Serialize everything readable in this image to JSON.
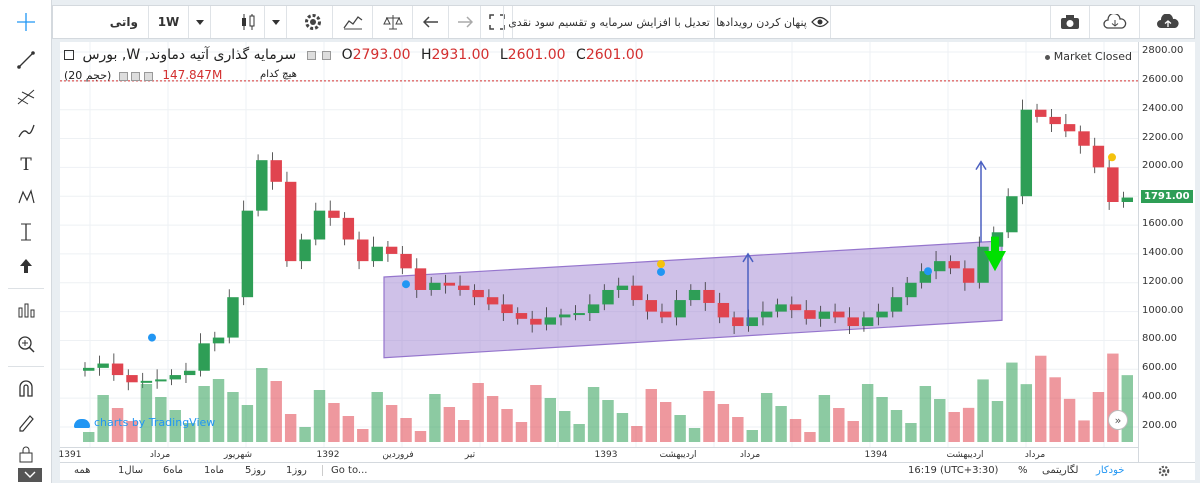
{
  "toolbar": {
    "symbol": "واتی",
    "interval": "1W",
    "hide_events": "پنهان کردن رویدادها",
    "adjust_label": "تعدیل با افزایش سرمایه و تقسیم سود نقدی"
  },
  "legend": {
    "title": "سرمایه گذاری آتیه دماوند, W, بورس",
    "o_label": "O",
    "o_value": "2793.00",
    "h_label": "H",
    "h_value": "2931.00",
    "l_label": "L",
    "l_value": "2601.00",
    "c_label": "C",
    "c_value": "2601.00",
    "volume_label": "(حجم 20)",
    "volume_value": "147.847M",
    "none_label": "هیچ کدام"
  },
  "market_status": "Market Closed",
  "last_price": "1791.00",
  "watermark": "charts by TradingView",
  "y_ticks": [
    "2800.00",
    "2600.00",
    "2400.00",
    "2200.00",
    "2000.00",
    "1800.00",
    "1600.00",
    "1400.00",
    "1200.00",
    "1000.00",
    "800.00",
    "600.00",
    "400.00",
    "200.00"
  ],
  "x_ticks": [
    "1391",
    "مرداد",
    "شهریور",
    "1392",
    "فروردین",
    "تیر",
    "1393",
    "اردیبهشت",
    "مرداد",
    "1394",
    "اردیبهشت",
    "مرداد"
  ],
  "bottom": {
    "ranges": [
      "همه",
      "1سال",
      "6ماه",
      "1ماه",
      "5روز",
      "1روز"
    ],
    "goto": "Go to...",
    "time": "16:19 (UTC+3:30)",
    "percent": "%",
    "log": "لگاریتمی",
    "auto": "خودکار"
  },
  "colors": {
    "up": "#26a69a",
    "down": "#ef5350",
    "channel": "#9575cd",
    "arrow": "#4a5fc1",
    "green_arrow": "#00e000",
    "accent": "#d32f2f"
  },
  "chart_data": {
    "type": "candlestick",
    "interval": "1W",
    "y_range": [
      0,
      2900
    ],
    "channel": {
      "start_low": 680,
      "start_high": 1240,
      "end_low": 940,
      "end_high": 1490
    },
    "closes": [
      610,
      640,
      560,
      510,
      520,
      530,
      560,
      590,
      780,
      820,
      1100,
      1700,
      2050,
      1900,
      1350,
      1500,
      1700,
      1650,
      1500,
      1350,
      1450,
      1400,
      1300,
      1150,
      1200,
      1180,
      1150,
      1100,
      1050,
      990,
      950,
      910,
      960,
      980,
      990,
      1050,
      1150,
      1180,
      1080,
      1000,
      960,
      1080,
      1150,
      1060,
      960,
      900,
      960,
      1000,
      1050,
      1010,
      950,
      1000,
      960,
      900,
      960,
      1000,
      1100,
      1200,
      1280,
      1350,
      1300,
      1200,
      1450,
      1550,
      1800,
      2400,
      2350,
      2300,
      2250,
      2150,
      2000,
      1760,
      1791
    ],
    "volume_peak_m": 147.847
  }
}
